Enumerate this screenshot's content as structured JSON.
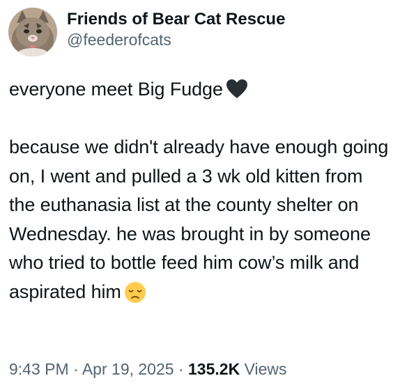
{
  "author": {
    "display_name": "Friends of Bear Cat Rescue",
    "handle": "@feederofcats",
    "avatar_icon": "cat-avatar-icon"
  },
  "tweet": {
    "line1": "everyone meet Big Fudge",
    "line1_emoji": "black-heart-icon",
    "paragraph2": "because we didn't already have enough going on, I went and pulled a 3 wk old kitten from the euthanasia list at the county shelter on Wednesday. he was brought in by someone who tried to bottle feed him cow’s milk and aspirated him",
    "paragraph2_emoji": "disappointed-face-icon"
  },
  "meta": {
    "time": "9:43 PM",
    "separator": "·",
    "date": "Apr 19, 2025",
    "views_count": "135.2K",
    "views_label": "Views"
  },
  "colors": {
    "text": "#0f1419",
    "secondary": "#536471"
  }
}
